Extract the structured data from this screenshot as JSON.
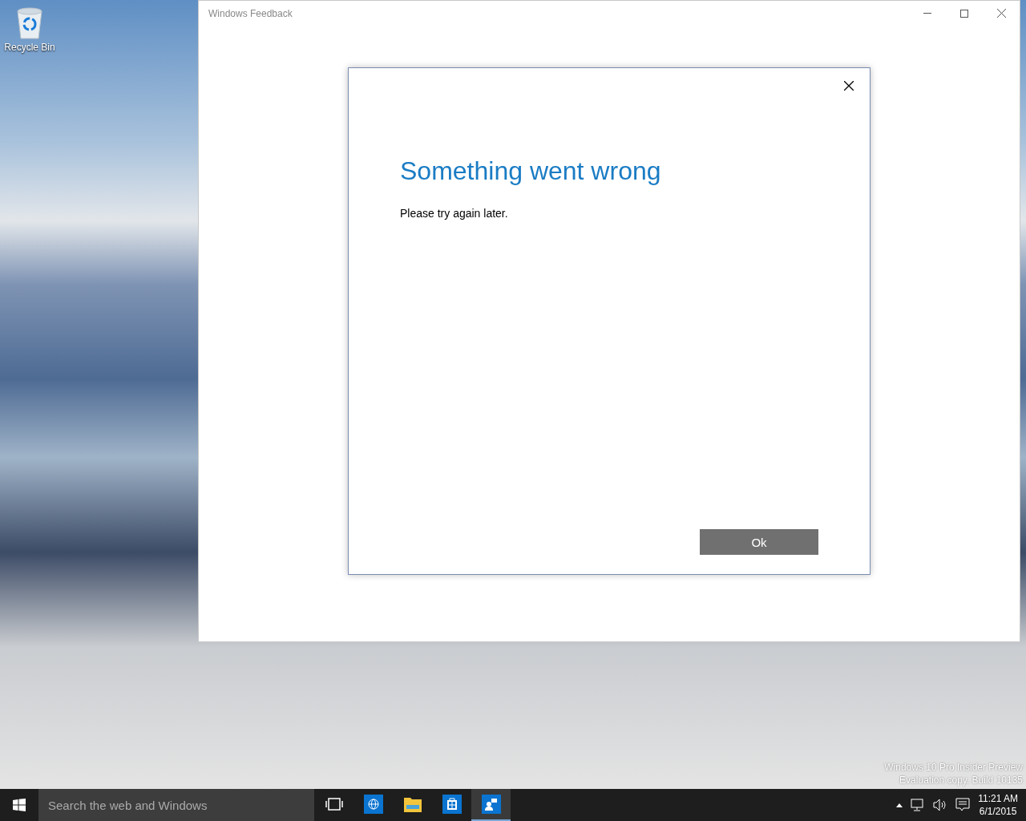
{
  "desktop": {
    "icons": [
      {
        "label": "Recycle Bin"
      }
    ],
    "build_info": [
      "Windows 10 Pro Insider Preview",
      "Evaluation copy. Build 10135"
    ]
  },
  "window": {
    "title": "Windows Feedback"
  },
  "dialog": {
    "title": "Something went wrong",
    "message": "Please try again later.",
    "buttons": [
      "Ok"
    ]
  },
  "taskbar": {
    "search": {
      "placeholder": "Search the web and Windows"
    },
    "apps": [
      {
        "kind": "taskview",
        "selected": false
      },
      {
        "kind": "browser",
        "selected": false
      },
      {
        "kind": "explorer",
        "selected": false
      },
      {
        "kind": "store",
        "selected": false
      },
      {
        "kind": "feedback",
        "selected": true
      }
    ],
    "clock": {
      "time": "11:21 AM",
      "date": "6/1/2015"
    }
  }
}
